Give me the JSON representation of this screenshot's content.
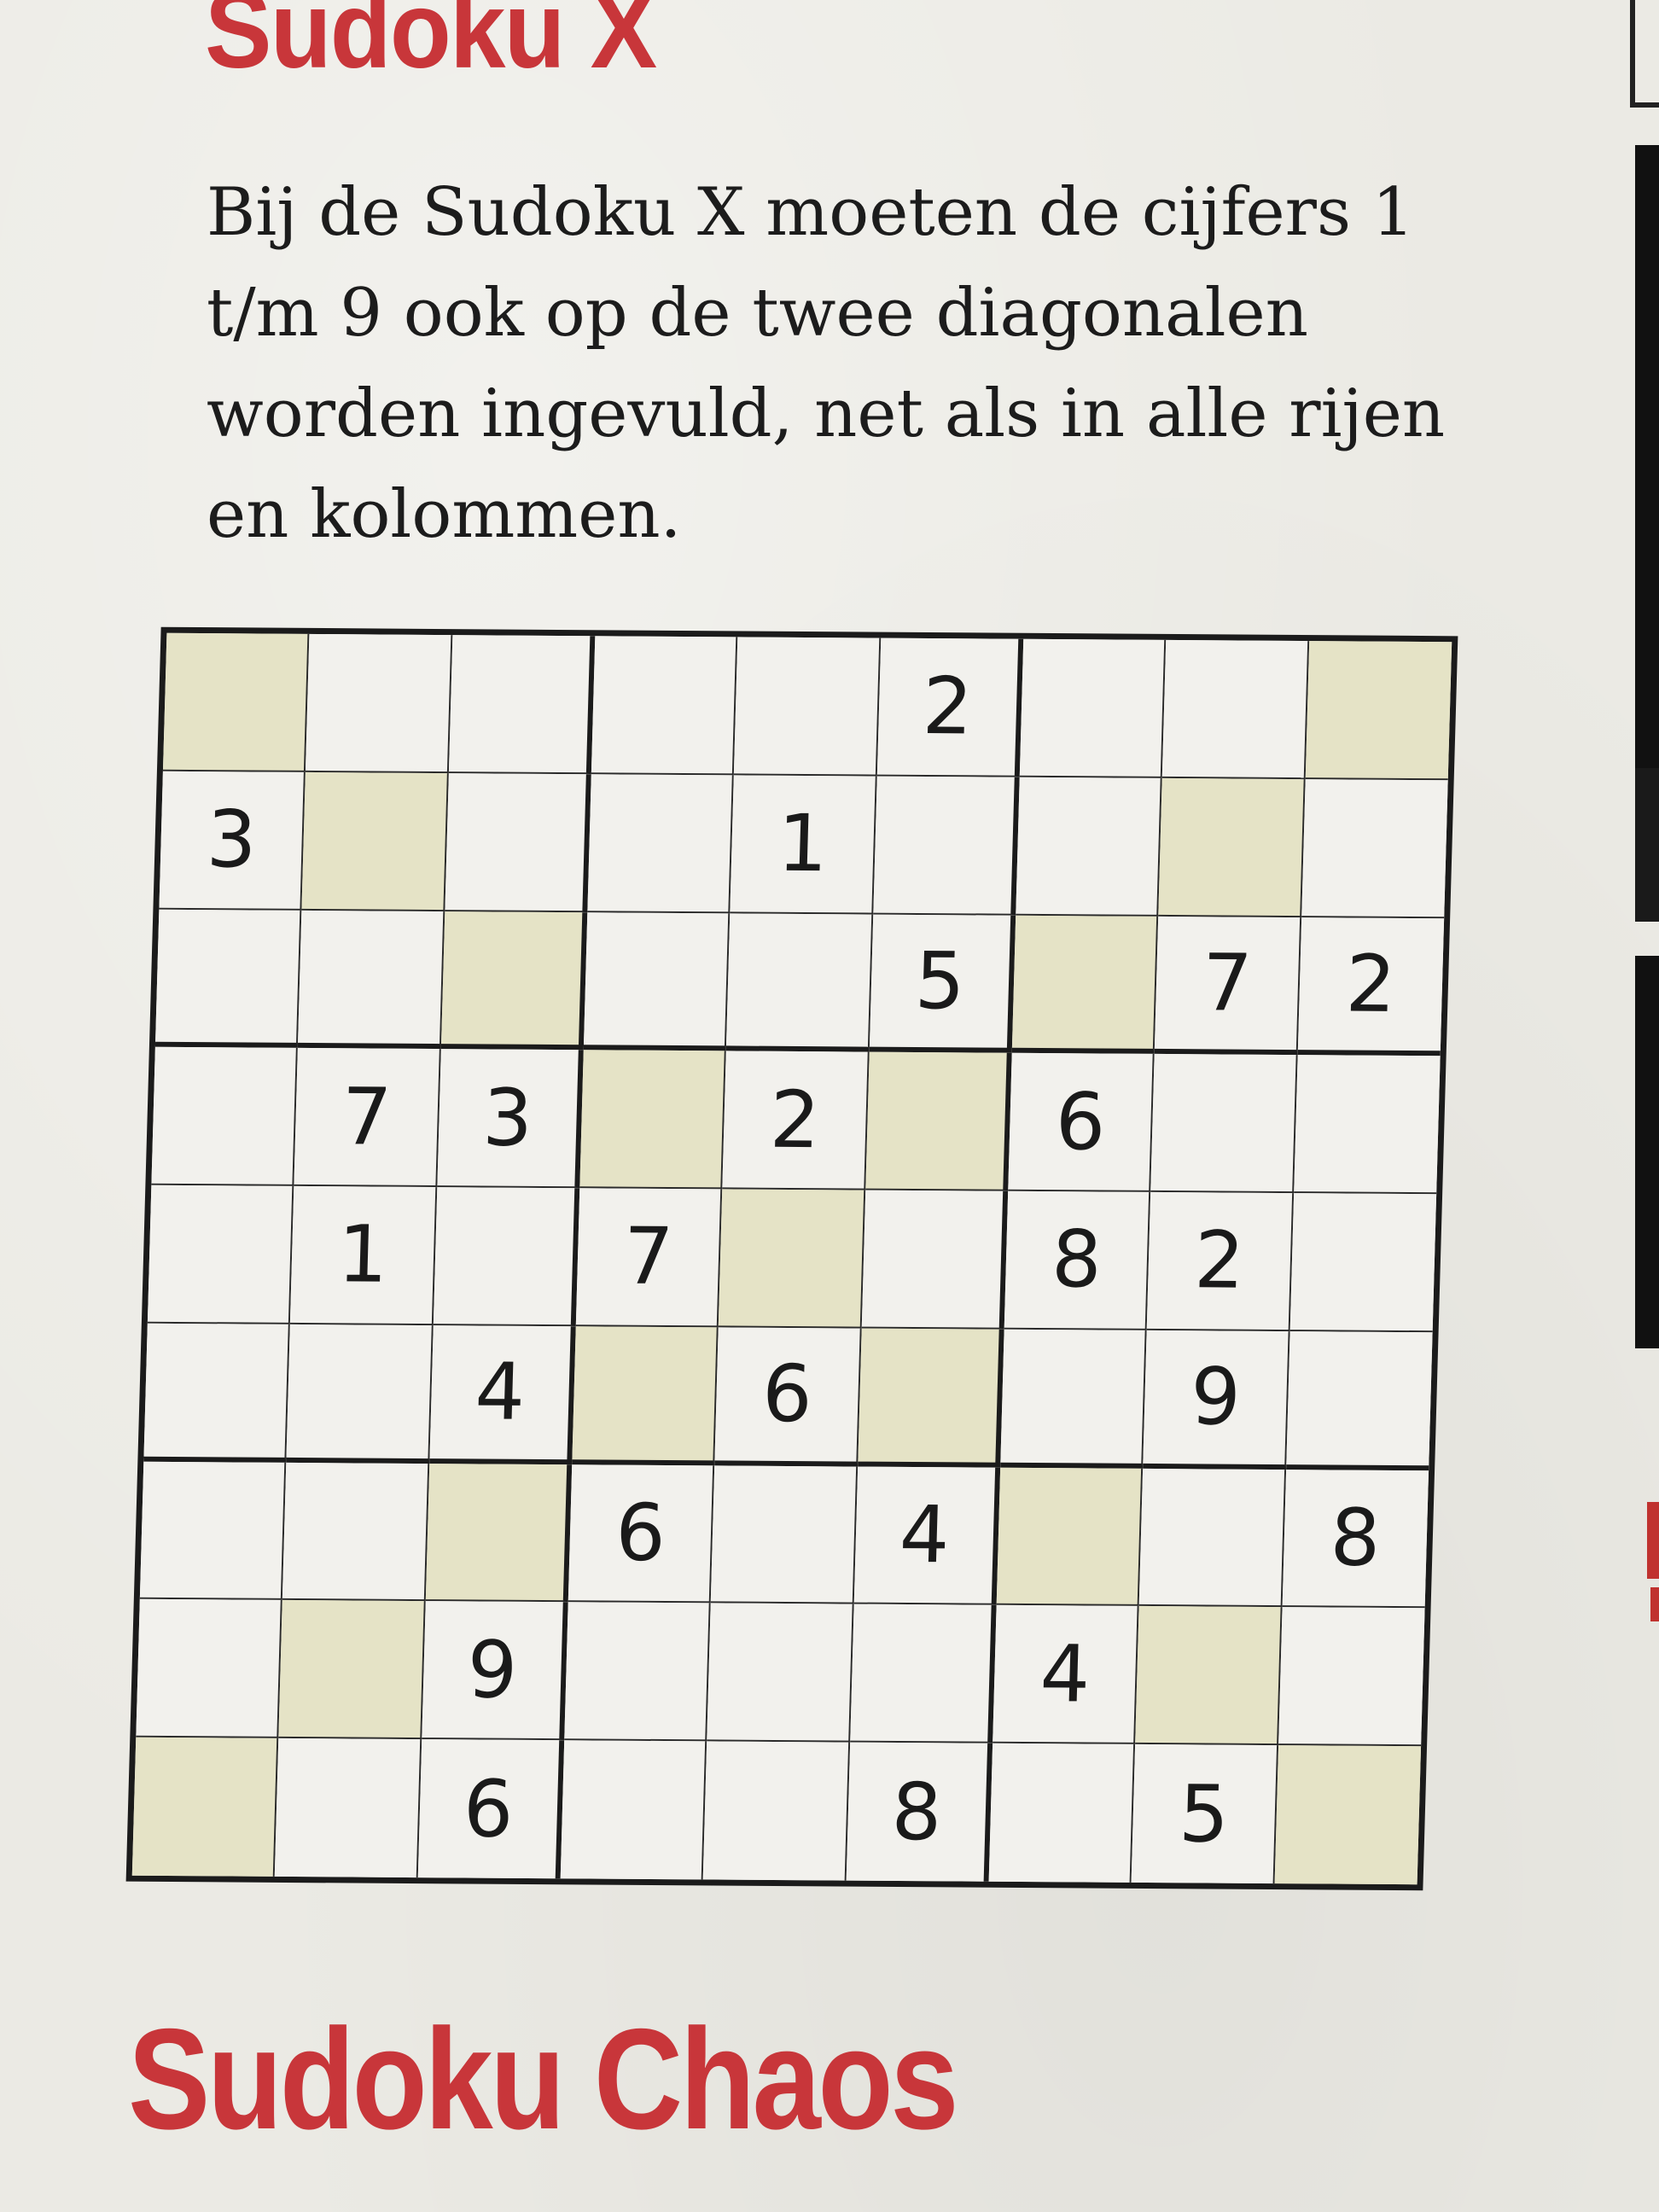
{
  "puzzle": {
    "title": "Sudoku X",
    "instructions": "Bij de Sudoku X moeten de cijfers 1 t/m 9 ook op de twee diagonalen worden ingevuld, net als in alle rijen en kolommen.",
    "grid": [
      [
        "",
        "",
        "",
        "",
        "",
        "2",
        "",
        "",
        ""
      ],
      [
        "3",
        "",
        "",
        "",
        "1",
        "",
        "",
        "",
        ""
      ],
      [
        "",
        "",
        "",
        "",
        "",
        "5",
        "",
        "7",
        "2"
      ],
      [
        "",
        "7",
        "3",
        "",
        "2",
        "",
        "6",
        "",
        ""
      ],
      [
        "",
        "1",
        "",
        "7",
        "",
        "",
        "8",
        "2",
        ""
      ],
      [
        "",
        "",
        "4",
        "",
        "6",
        "",
        "",
        "9",
        ""
      ],
      [
        "",
        "",
        "",
        "6",
        "",
        "4",
        "",
        "",
        "8"
      ],
      [
        "",
        "",
        "9",
        "",
        "",
        "",
        "4",
        "",
        ""
      ],
      [
        "",
        "",
        "6",
        "",
        "",
        "8",
        "",
        "5",
        ""
      ]
    ],
    "diagonal_highlight_color": "#e5e3c6"
  },
  "next_section": {
    "title": "Sudoku Chaos"
  },
  "colors": {
    "heading": "#c8363a",
    "text": "#1c1c1c",
    "paper": "#ebeae4"
  }
}
